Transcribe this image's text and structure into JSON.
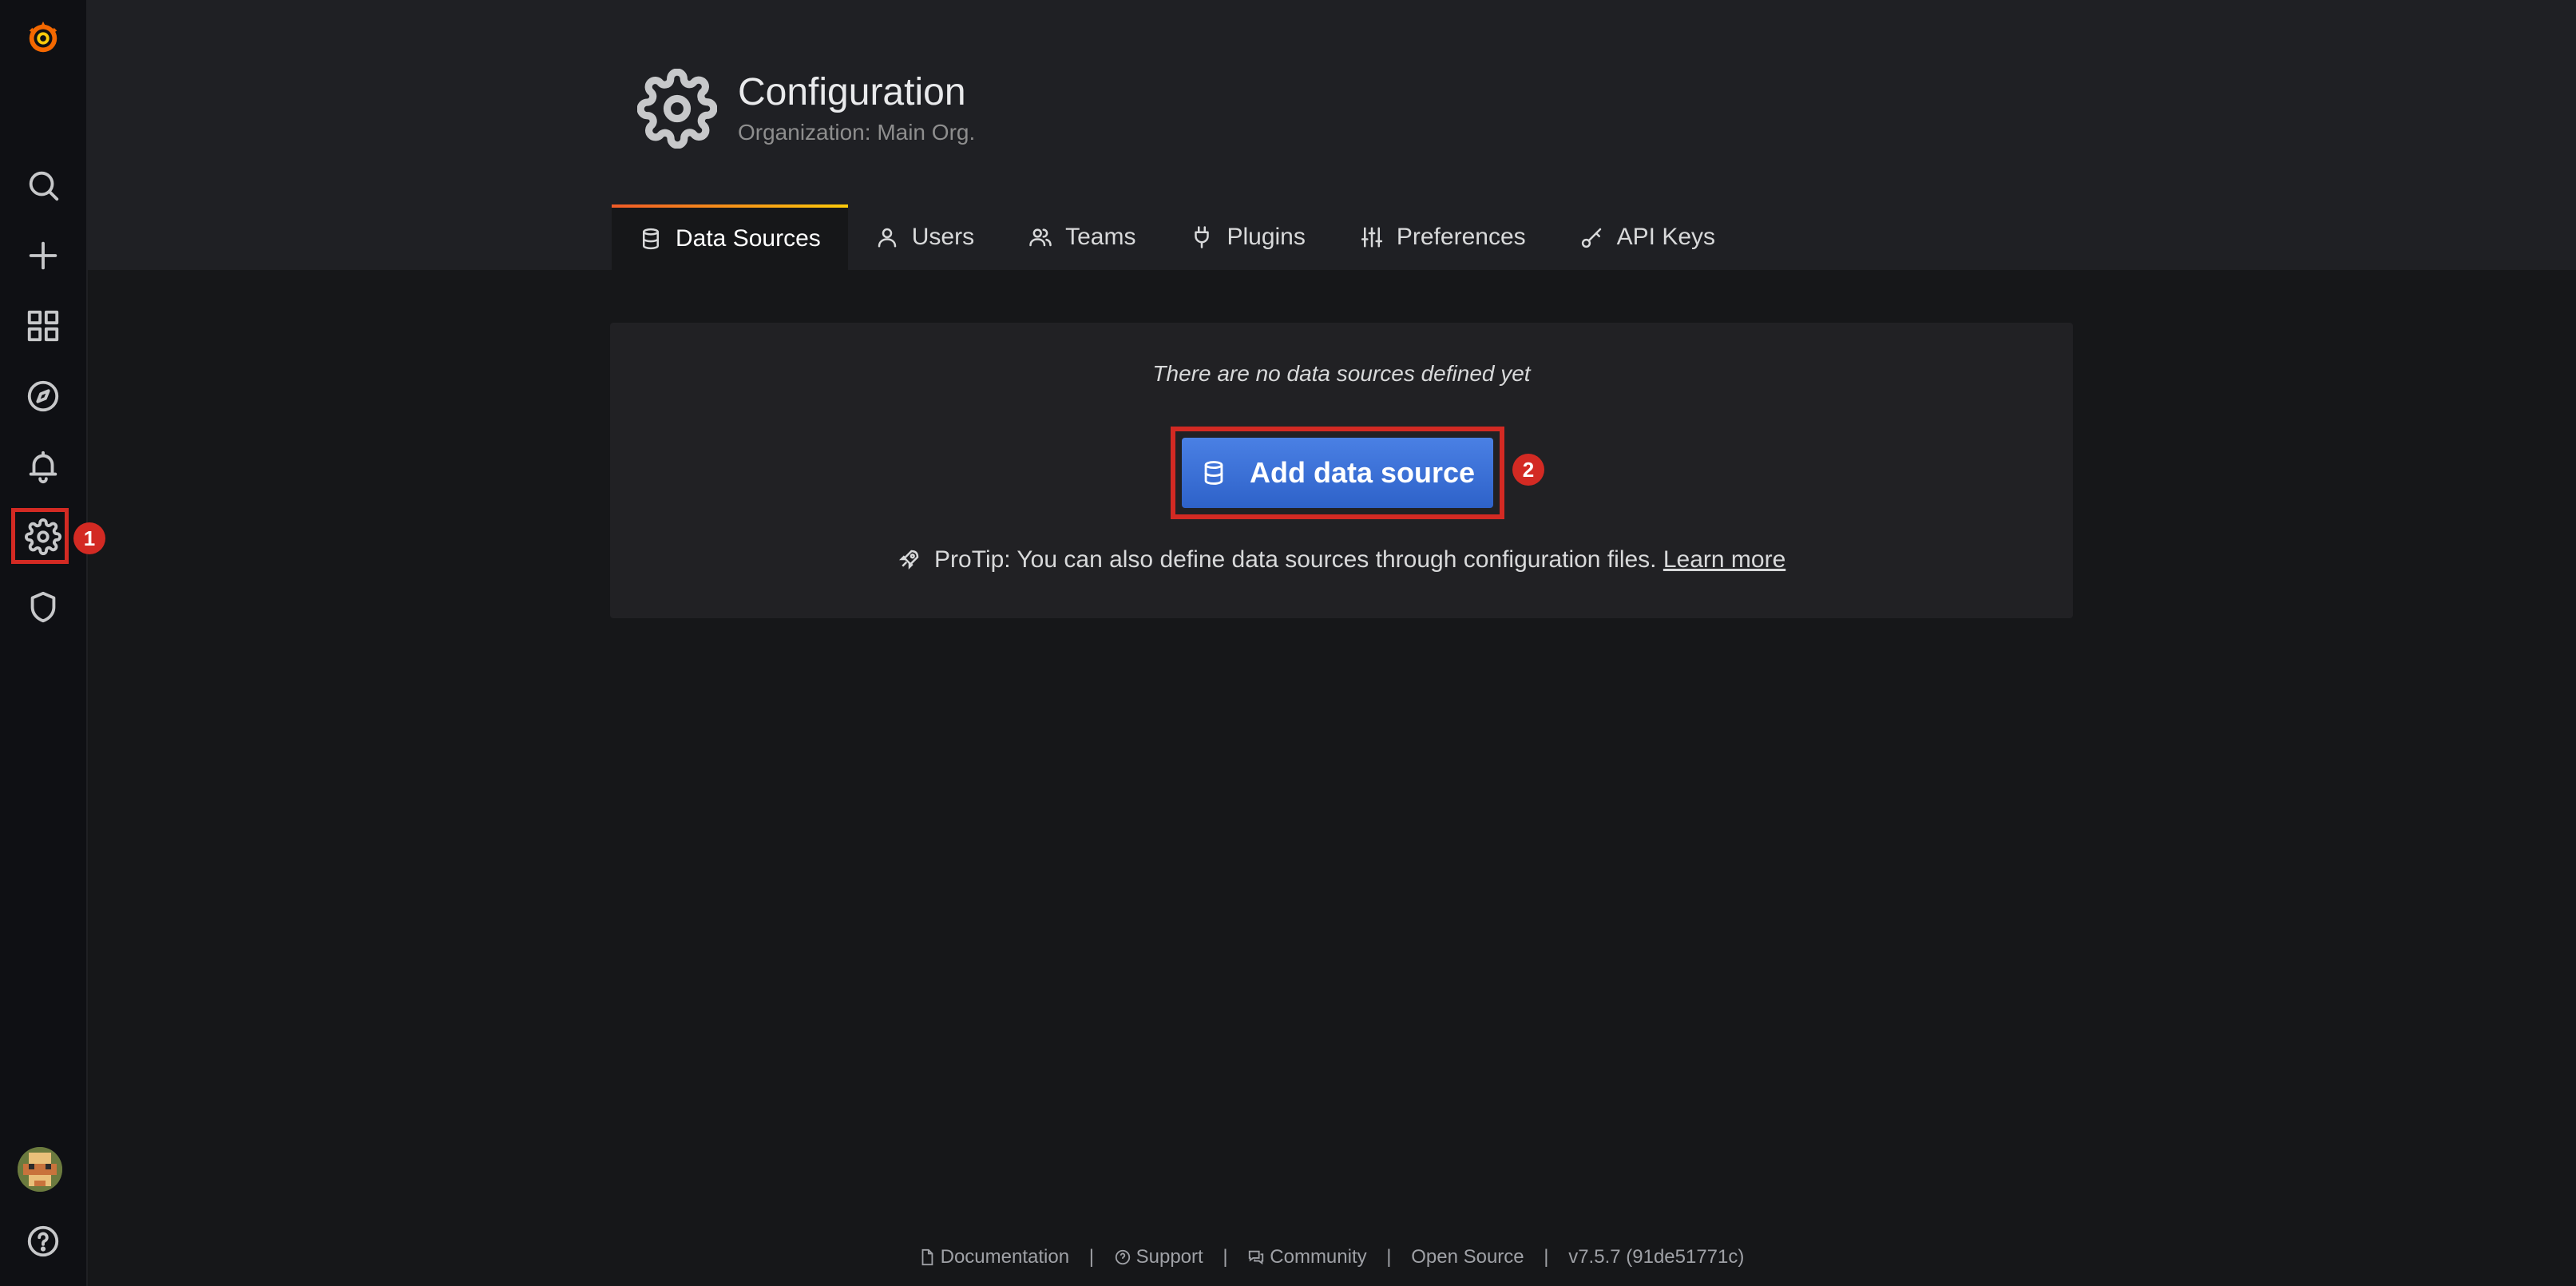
{
  "sidebar": {
    "items": [
      {
        "name": "search"
      },
      {
        "name": "create"
      },
      {
        "name": "dashboards"
      },
      {
        "name": "explore"
      },
      {
        "name": "alerting"
      },
      {
        "name": "configuration"
      },
      {
        "name": "server-admin"
      }
    ],
    "step_badge_1": "1"
  },
  "header": {
    "title": "Configuration",
    "subtitle": "Organization: Main Org."
  },
  "tabs": [
    {
      "label": "Data Sources",
      "active": true
    },
    {
      "label": "Users"
    },
    {
      "label": "Teams"
    },
    {
      "label": "Plugins"
    },
    {
      "label": "Preferences"
    },
    {
      "label": "API Keys"
    }
  ],
  "panel": {
    "empty_message": "There are no data sources defined yet",
    "add_button_label": "Add data source",
    "step_badge_2": "2",
    "protip_text": "ProTip: You can also define data sources through configuration files.",
    "protip_link": "Learn more"
  },
  "footer": {
    "documentation": "Documentation",
    "support": "Support",
    "community": "Community",
    "open_source": "Open Source",
    "version": "v7.5.7 (91de51771c)",
    "separator": "|"
  },
  "colors": {
    "accent_blue": "#3871dc",
    "annotation_red": "#d32a23",
    "tab_gradient_start": "#f05a28",
    "tab_gradient_end": "#fbca0a"
  }
}
